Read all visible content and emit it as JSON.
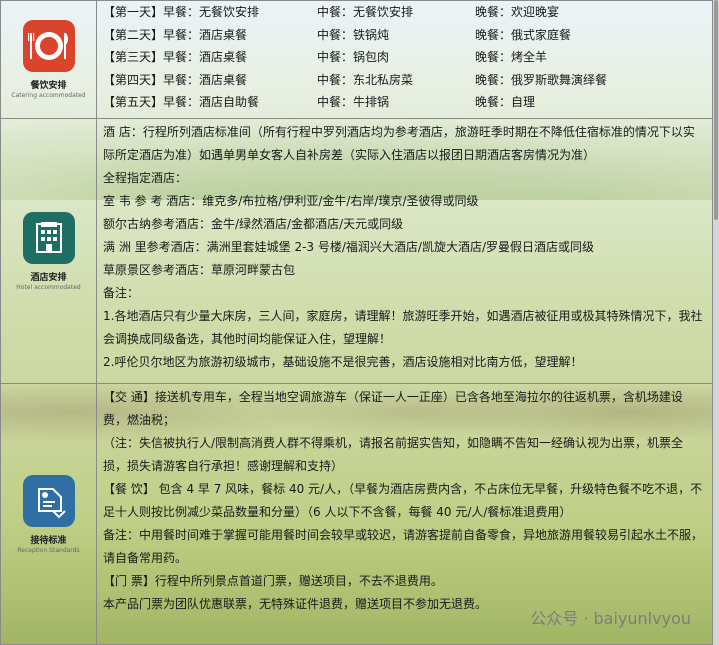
{
  "catering": {
    "icon_title": "餐饮安排",
    "icon_sub": "Catering accommodated",
    "days": [
      {
        "day": "【第一天】早餐：无餐饮安排",
        "lunch": "中餐：无餐饮安排",
        "dinner": "晚餐：欢迎晚宴"
      },
      {
        "day": "【第二天】早餐：酒店桌餐",
        "lunch": "中餐：铁锅炖",
        "dinner": "晚餐：俄式家庭餐"
      },
      {
        "day": "【第三天】早餐：酒店桌餐",
        "lunch": "中餐：锅包肉",
        "dinner": "晚餐：烤全羊"
      },
      {
        "day": "【第四天】早餐：酒店桌餐",
        "lunch": "中餐：东北私房菜",
        "dinner": "晚餐：俄罗斯歌舞演绎餐"
      },
      {
        "day": "【第五天】早餐：酒店自助餐",
        "lunch": "中餐：牛排锅",
        "dinner": "晚餐：自理"
      }
    ]
  },
  "hotel": {
    "icon_title": "酒店安排",
    "icon_sub": "Hotel accommodated",
    "standard": "酒 店：行程所列酒店标准间（所有行程中罗列酒店均为参考酒店，旅游旺季时期在不降低住宿标准的情况下以实际所定酒店为准）如遇单男单女客人自补房差（实际入住酒店以报团日期酒店客房情况为准）",
    "all_title": "全程指定酒店：",
    "lines": [
      "室 韦 参 考 酒店：维克多/布拉格/伊利亚/金牛/右岸/璞京/圣彼得或同级",
      "额尔古纳参考酒店：金牛/绿然酒店/金都酒店/天元或同级",
      "满 洲 里参考酒店：满洲里套娃城堡 2-3 号楼/福润兴大酒店/凯旋大酒店/罗曼假日酒店或同级",
      "草原景区参考酒店：草原河畔蒙古包"
    ],
    "notes_title": "备注：",
    "notes": [
      "1.各地酒店只有少量大床房，三人间，家庭房，请理解！旅游旺季开始，如遇酒店被征用或极其特殊情况下，我社会调换成同级备选，其他时间均能保证入住，望理解！",
      "2.呼伦贝尔地区为旅游初级城市，基础设施不是很完善，酒店设施相对比南方低，望理解！"
    ]
  },
  "reception": {
    "icon_title": "接待标准",
    "icon_sub": "Reception Standards",
    "transport": "【交 通】接送机专用车，全程当地空调旅游车（保证一人一正座）已含各地至海拉尔的往返机票，含机场建设费，燃油税；",
    "transport_note": "（注：失信被执行人/限制高消费人群不得乘机，请报名前据实告知，如隐瞒不告知一经确认视为出票，机票全损，损失请游客自行承担！感谢理解和支持）",
    "meals": "【餐 饮】 包含 4 早 7 风味，餐标 40 元/人，（早餐为酒店房费内含，不占床位无早餐，升级特色餐不吃不退，不足十人则按比例减少菜品数量和分量）（6 人以下不含餐，每餐 40 元/人/餐标准退费用）",
    "meals_note": "备注：中用餐时间难于掌握可能用餐时间会较早或较迟，请游客提前自备零食，异地旅游用餐较易引起水土不服，请自备常用药。",
    "tickets": "【门 票】行程中所列景点首道门票，赠送项目，不去不退费用。",
    "tickets_note": "本产品门票为团队优惠联票，无特殊证件退费，赠送项目不参加无退费。"
  },
  "watermark": "公众号 · baiyunlvyou",
  "colors": {
    "catering": "#d9442b",
    "hotel": "#1e6e66",
    "reception": "#2f6fa3"
  }
}
